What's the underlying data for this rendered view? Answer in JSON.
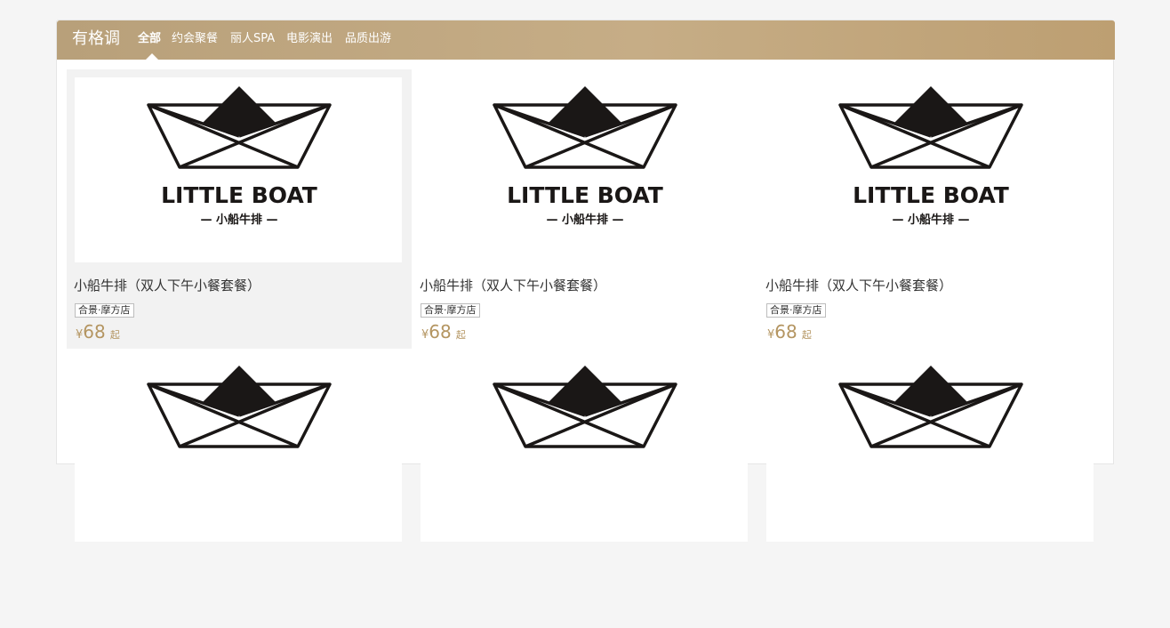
{
  "header": {
    "brand": "有格调",
    "tabs": [
      "全部",
      "约会聚餐",
      "丽人SPA",
      "电影演出",
      "品质出游"
    ]
  },
  "deals": [
    {
      "title": "小船牛排（双人下午小餐套餐）",
      "tag": "合景·摩方店",
      "currency": "¥",
      "price": "68",
      "suffix": "起",
      "logo_text": "LITTLE BOAT",
      "logo_sub": "— 小船牛排 —"
    },
    {
      "title": "小船牛排（双人下午小餐套餐）",
      "tag": "合景·摩方店",
      "currency": "¥",
      "price": "68",
      "suffix": "起",
      "logo_text": "LITTLE BOAT",
      "logo_sub": "— 小船牛排 —"
    },
    {
      "title": "小船牛排（双人下午小餐套餐）",
      "tag": "合景·摩方店",
      "currency": "¥",
      "price": "68",
      "suffix": "起",
      "logo_text": "LITTLE BOAT",
      "logo_sub": "— 小船牛排 —"
    },
    {
      "logo_text": "",
      "logo_sub": ""
    },
    {
      "logo_text": "",
      "logo_sub": ""
    },
    {
      "logo_text": "",
      "logo_sub": ""
    }
  ],
  "colors": {
    "header_gradient_start": "#b8a07a",
    "header_gradient_end": "#bd9f72",
    "price": "#b49561",
    "hover_bg": "#f2f2f2"
  },
  "icons": [
    "boat-logo-icon"
  ]
}
